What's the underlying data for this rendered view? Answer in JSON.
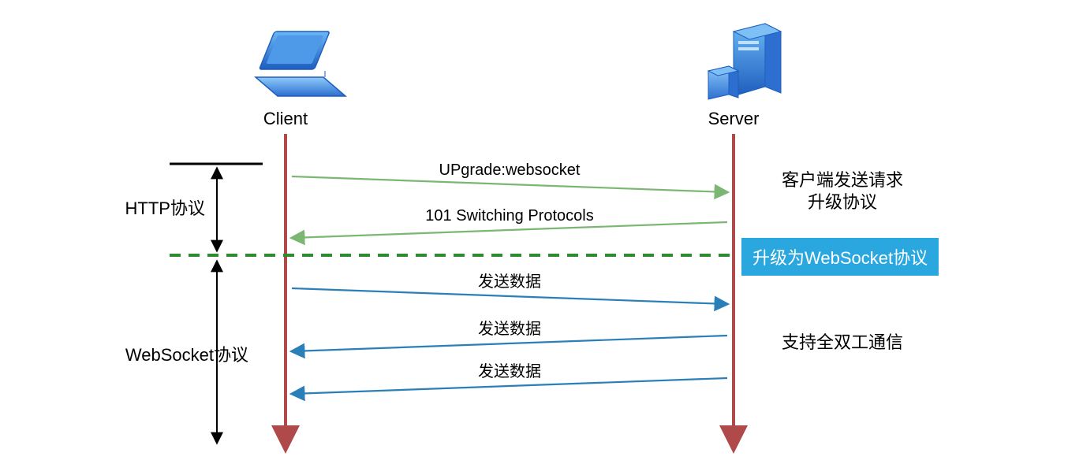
{
  "participants": {
    "client_label": "Client",
    "server_label": "Server"
  },
  "phases": {
    "http_label": "HTTP协议",
    "ws_label": "WebSocket协议"
  },
  "messages": {
    "upgrade": "UPgrade:websocket",
    "switching": "101 Switching Protocols",
    "send1": "发送数据",
    "send2": "发送数据",
    "send3": "发送数据"
  },
  "notes": {
    "client_request_line1": "客户端发送请求",
    "client_request_line2": "升级协议",
    "upgrade_badge": "升级为WebSocket协议",
    "full_duplex": "支持全双工通信"
  },
  "colors": {
    "lifeline": "#B04A4A",
    "http_arrow": "#7BB673",
    "ws_arrow": "#2A7FB8",
    "divider": "#2E8B2E",
    "phase_arrow": "#000000",
    "badge_bg": "#2AA7DF"
  }
}
